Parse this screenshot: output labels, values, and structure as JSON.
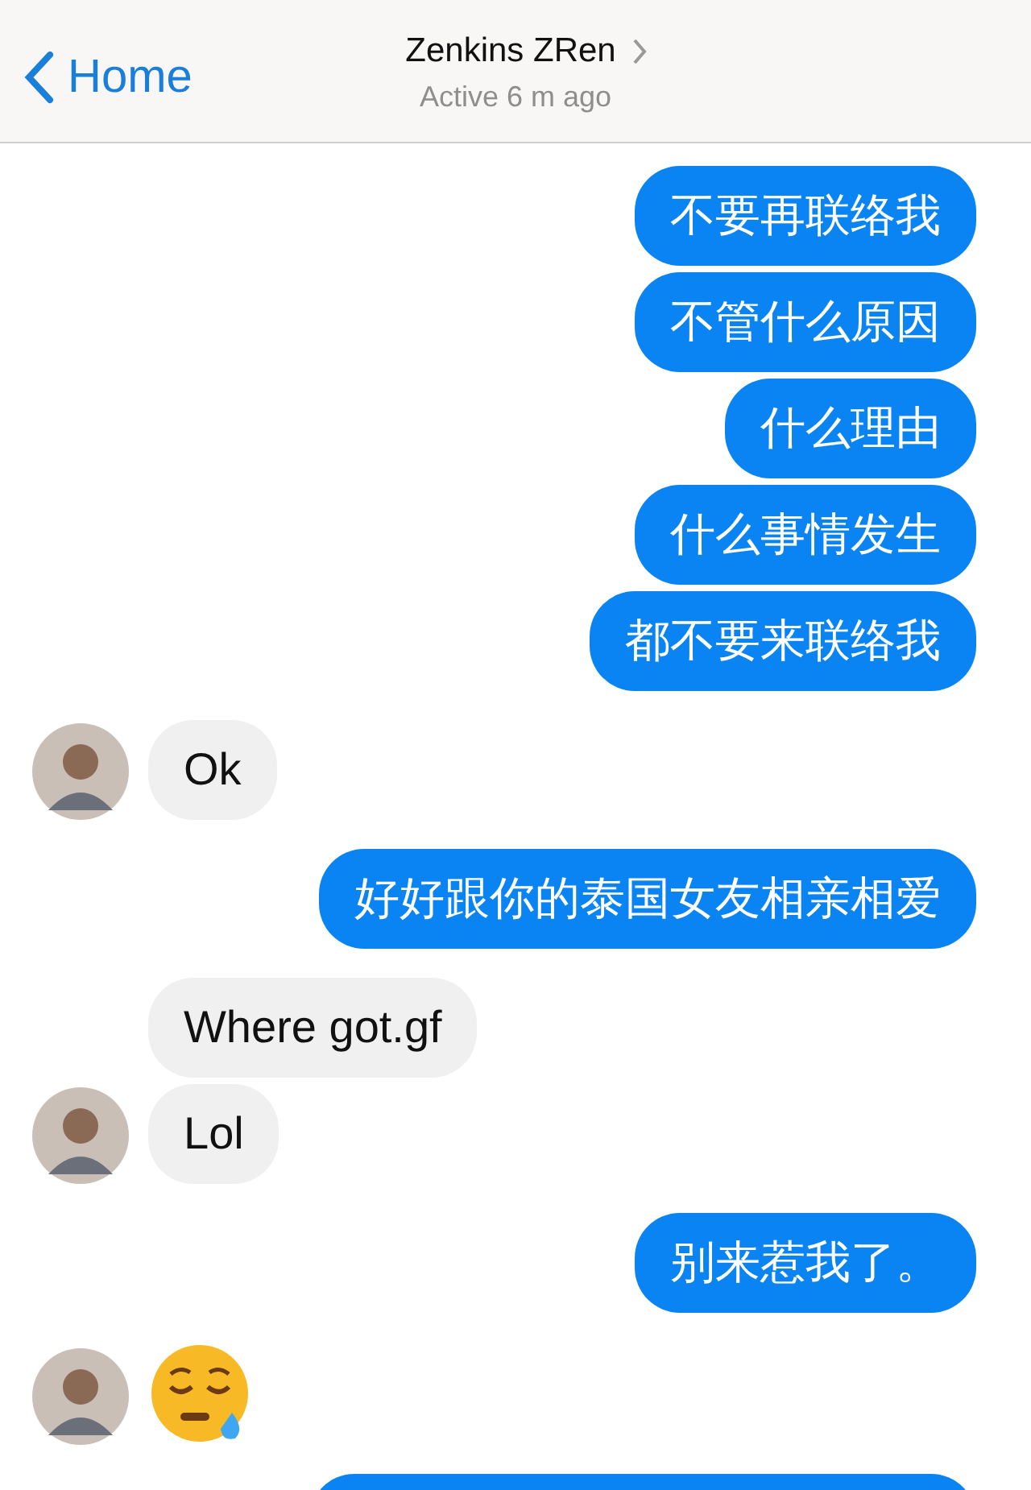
{
  "header": {
    "back_label": "Home",
    "contact_name": "Zenkins ZRen",
    "status": "Active 6 m ago"
  },
  "messages": [
    {
      "outgoing": true,
      "kind": "text",
      "text": "不要再联络我"
    },
    {
      "outgoing": true,
      "kind": "text",
      "text": "不管什么原因"
    },
    {
      "outgoing": true,
      "kind": "text",
      "text": "什么理由"
    },
    {
      "outgoing": true,
      "kind": "text",
      "text": "什么事情发生"
    },
    {
      "outgoing": true,
      "kind": "text",
      "text": "都不要来联络我"
    },
    {
      "outgoing": false,
      "kind": "text",
      "text": "Ok",
      "avatar": true
    },
    {
      "outgoing": true,
      "kind": "text",
      "text": "好好跟你的泰国女友相亲相爱"
    },
    {
      "outgoing": false,
      "kind": "text",
      "text": "Where got.gf",
      "avatar": false
    },
    {
      "outgoing": false,
      "kind": "text",
      "text": "Lol",
      "avatar": true
    },
    {
      "outgoing": true,
      "kind": "text",
      "text": "别来惹我了。"
    },
    {
      "outgoing": false,
      "kind": "sticker",
      "avatar": true
    },
    {
      "outgoing": true,
      "kind": "hidden"
    }
  ]
}
